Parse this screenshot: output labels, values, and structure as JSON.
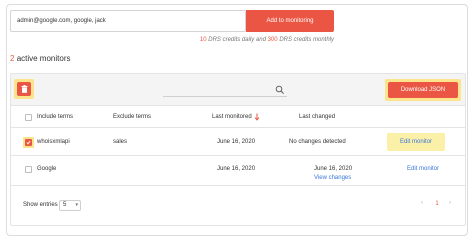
{
  "add_form": {
    "input_value": "admin@google.com, google, jack",
    "add_button_label": "Add to monitoring"
  },
  "credits": {
    "daily_count": "10",
    "daily_text": "DRS credits daily and",
    "monthly_count": "300",
    "monthly_text": "DRS credits monthly"
  },
  "active": {
    "count": "2",
    "label": "active monitors"
  },
  "toolbar": {
    "search_placeholder": "",
    "download_label": "Download JSON"
  },
  "table": {
    "headers": {
      "include": "Include terms",
      "exclude": "Exclude terms",
      "last_monitored": "Last monitored",
      "last_changed": "Last changed"
    },
    "rows": [
      {
        "include": "whoisxmlapi",
        "exclude": "sales",
        "last_monitored": "June 16, 2020",
        "last_changed": "No changes detected",
        "action": "Edit monitor",
        "checked": true
      },
      {
        "include": "Google",
        "exclude": "",
        "last_monitored": "June 16, 2020",
        "last_changed": "June 16, 2020",
        "view_changes": "View changes",
        "action": "Edit monitor",
        "checked": false
      }
    ]
  },
  "footer": {
    "show_entries_label": "Show entries",
    "entries_value": "5",
    "page_prev": "‹",
    "current_page": "1",
    "page_next": "›"
  },
  "colors": {
    "accent": "#ea5643",
    "highlight": "#fbe48c",
    "link": "#3a76d6"
  },
  "icons": {
    "delete": "trash-icon",
    "search": "search-icon",
    "sort": "sort-down-icon"
  }
}
